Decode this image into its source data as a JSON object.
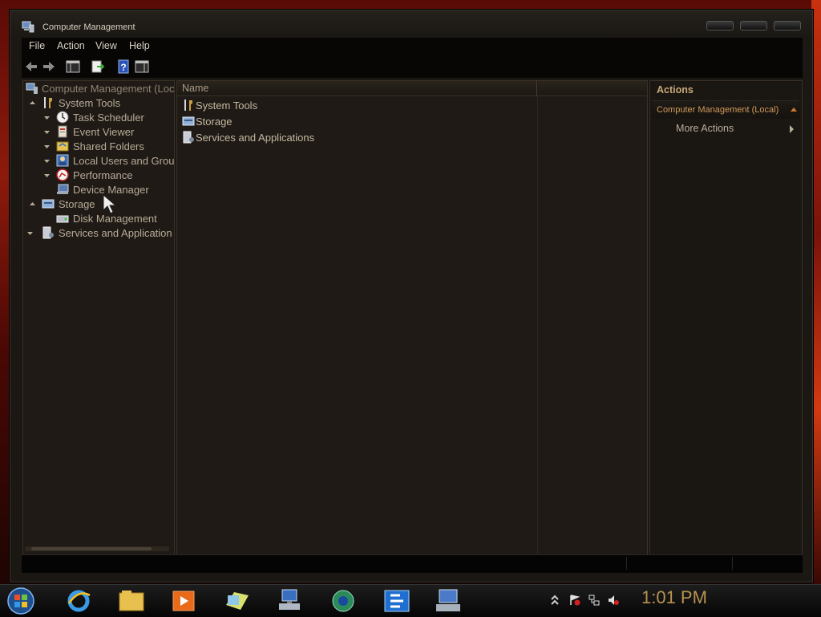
{
  "window": {
    "title": "Computer Management"
  },
  "menu": [
    "File",
    "Action",
    "View",
    "Help"
  ],
  "toolbar_icons": [
    "back-arrow-icon",
    "forward-arrow-icon",
    "show-hide-console-tree-icon",
    "export-list-icon",
    "help-icon",
    "properties-icon"
  ],
  "tree": {
    "root": "Computer Management (Loc",
    "items": [
      {
        "label": "System Tools",
        "icon": "tools-icon"
      },
      {
        "label": "Task Scheduler",
        "icon": "clock-icon"
      },
      {
        "label": "Event Viewer",
        "icon": "event-viewer-icon"
      },
      {
        "label": "Shared Folders",
        "icon": "shared-folders-icon"
      },
      {
        "label": "Local Users and Grou",
        "icon": "users-icon"
      },
      {
        "label": "Performance",
        "icon": "performance-icon"
      },
      {
        "label": "Device Manager",
        "icon": "device-manager-icon"
      },
      {
        "label": "Storage",
        "icon": "storage-icon"
      },
      {
        "label": "Disk Management",
        "icon": "disk-icon"
      },
      {
        "label": "Services and Application",
        "icon": "services-icon"
      }
    ]
  },
  "list": {
    "columns": [
      "Name",
      ""
    ],
    "rows": [
      {
        "label": "System Tools",
        "icon": "tools-icon"
      },
      {
        "label": "Storage",
        "icon": "storage-icon"
      },
      {
        "label": "Services and Applications",
        "icon": "services-icon"
      }
    ]
  },
  "actions": {
    "title": "Actions",
    "section": "Computer Management (Local)",
    "more": "More Actions"
  },
  "taskbar": {
    "clock": "1:01 PM",
    "apps": [
      "internet-explorer-icon",
      "file-explorer-icon",
      "media-player-icon",
      "folder-shortcut-icon",
      "network-computer-icon",
      "browser-globe-icon",
      "remote-app-icon",
      "computer-management-icon"
    ],
    "tray": [
      "show-hidden-icons-icon",
      "action-center-flag-icon",
      "network-icon",
      "volume-muted-icon"
    ]
  },
  "colors": {
    "window_bg": "#1b1713",
    "text": "#b7ab98",
    "accent": "#d09a5a",
    "clock": "#b9934f"
  }
}
